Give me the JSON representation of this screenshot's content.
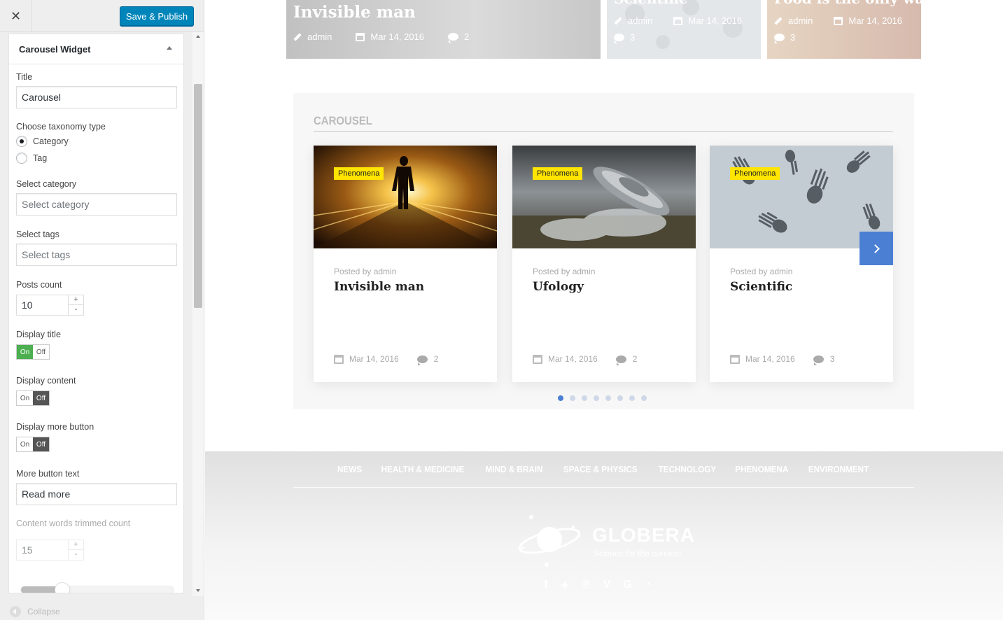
{
  "sidebar": {
    "close_label": "✕",
    "publish_label": "Save & Publish",
    "widget_title": "Carousel Widget",
    "fields": {
      "title_label": "Title",
      "title_value": "Carousel",
      "taxonomy_label": "Choose taxonomy type",
      "taxonomy_options": [
        "Category",
        "Tag"
      ],
      "taxonomy_selected": "Category",
      "category_label": "Select category",
      "category_placeholder": "Select category",
      "tags_label": "Select tags",
      "tags_placeholder": "Select tags",
      "posts_count_label": "Posts count",
      "posts_count_value": "10",
      "display_title_label": "Display title",
      "display_content_label": "Display content",
      "display_more_label": "Display more button",
      "toggle_on": "On",
      "toggle_off": "Off",
      "more_text_label": "More button text",
      "more_text_value": "Read more",
      "trim_label": "Content words trimmed count",
      "trim_value": "15",
      "stepper_plus": "+",
      "stepper_minus": "-"
    },
    "toggles": {
      "display_title": true,
      "display_content": false,
      "display_more_button": false
    },
    "collapse_label": "Collapse"
  },
  "preview": {
    "top_cards": [
      {
        "title": "Invisible man",
        "author": "admin",
        "date": "Mar 14, 2016",
        "comments": "2"
      },
      {
        "title": "Scientific",
        "author": "admin",
        "date": "Mar 14, 2016",
        "comments": "3"
      },
      {
        "title": "Food is the only way",
        "author": "admin",
        "date": "Mar 14, 2016",
        "comments": "3"
      }
    ],
    "carousel": {
      "title": "CAROUSEL",
      "posted_prefix": "Posted by admin",
      "cards": [
        {
          "badge": "Phenomena",
          "posted": "Posted by admin",
          "title": "Invisible man",
          "date": "Mar 14, 2016",
          "comments": "2"
        },
        {
          "badge": "Phenomena",
          "posted": "Posted by admin",
          "title": "Ufology",
          "date": "Mar 14, 2016",
          "comments": "2"
        },
        {
          "badge": "Phenomena",
          "posted": "Posted by admin",
          "title": "Scientific",
          "date": "Mar 14, 2016",
          "comments": "3"
        }
      ],
      "dot_count": 8,
      "active_dot": 0
    },
    "footer": {
      "nav": [
        "NEWS",
        "HEALTH & MEDICINE",
        "MIND & BRAIN",
        "SPACE & PHYSICS",
        "TECHNOLOGY",
        "PHENOMENA",
        "ENVIRONMENT"
      ],
      "brand": "GLOBERA",
      "tagline": "Science for the curious!",
      "social": [
        "f",
        "t",
        "p",
        "v",
        "G",
        "rss"
      ]
    }
  },
  "colors": {
    "publish": "#0085ba",
    "accent": "#4a7fd4",
    "badge": "#ffe500",
    "toggle_on": "#4caf50"
  }
}
